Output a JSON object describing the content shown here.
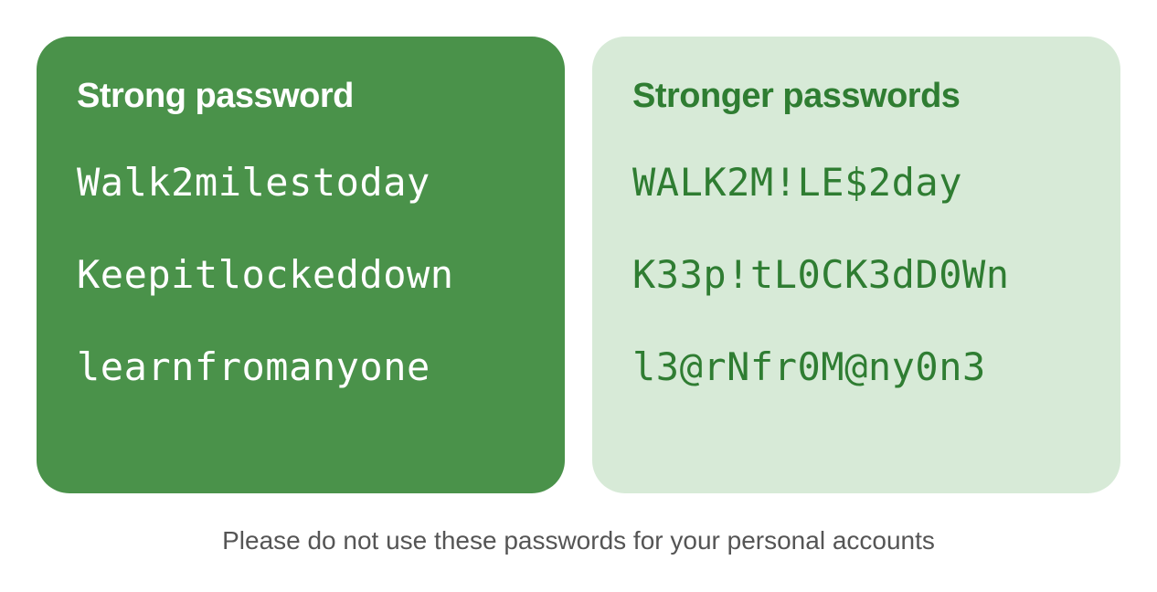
{
  "cards": {
    "left": {
      "heading": "Strong password",
      "items": [
        "Walk2milestoday",
        "Keepitlockeddown",
        "learnfromanyone"
      ]
    },
    "right": {
      "heading": "Stronger passwords",
      "items": [
        "WALK2M!LE$2day",
        "K33p!tL0CK3dD0Wn",
        "l3@rNfr0M@ny0n3"
      ]
    }
  },
  "footnote": "Please do not use these passwords for your personal accounts"
}
